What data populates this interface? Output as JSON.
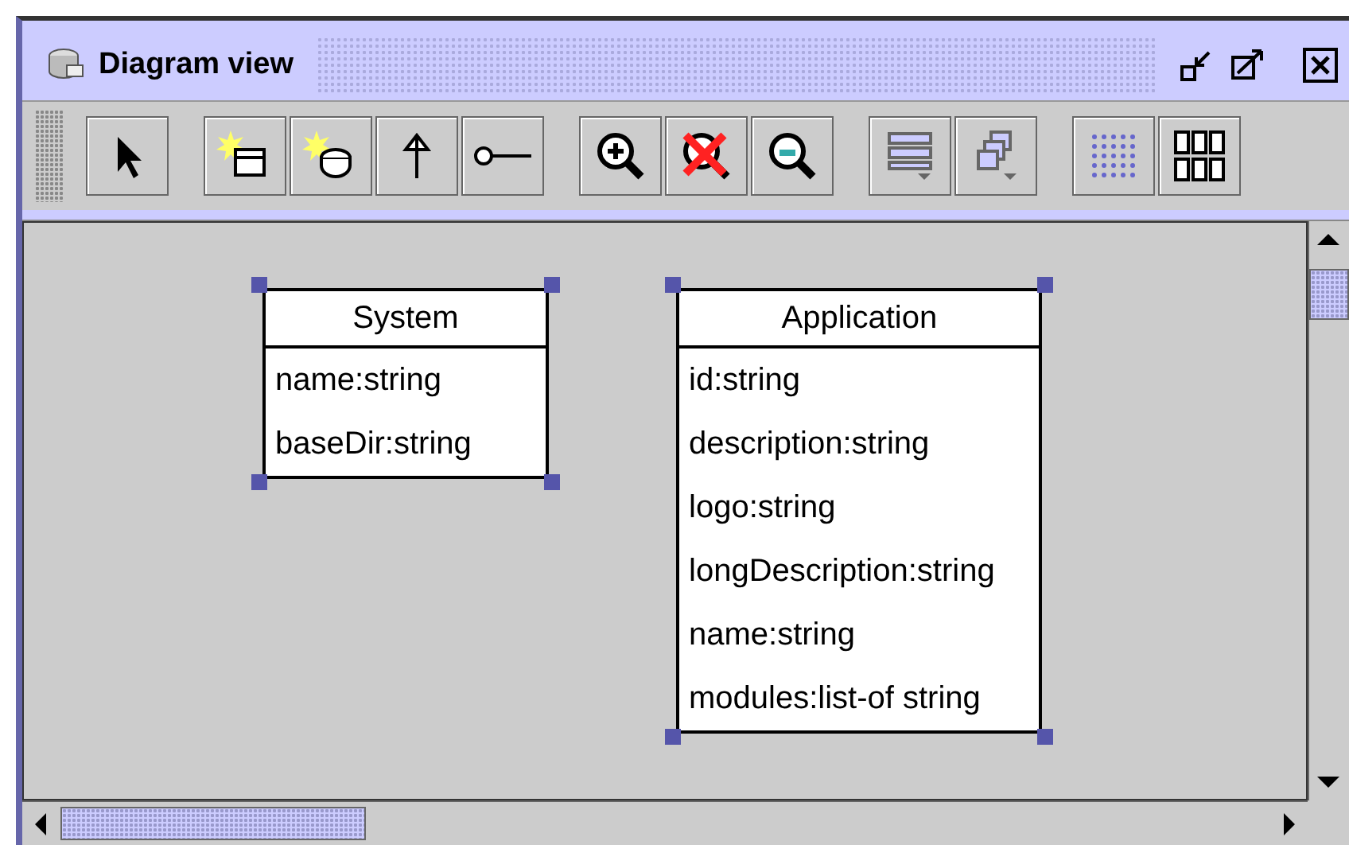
{
  "window": {
    "title": "Diagram view"
  },
  "classes": [
    {
      "name": "System",
      "selected": true,
      "attributes": [
        "name:string",
        "baseDir:string"
      ]
    },
    {
      "name": "Application",
      "selected": true,
      "attributes": [
        "id:string",
        "description:string",
        "logo:string",
        "longDescription:string",
        "name:string",
        "modules:list-of string"
      ]
    }
  ]
}
